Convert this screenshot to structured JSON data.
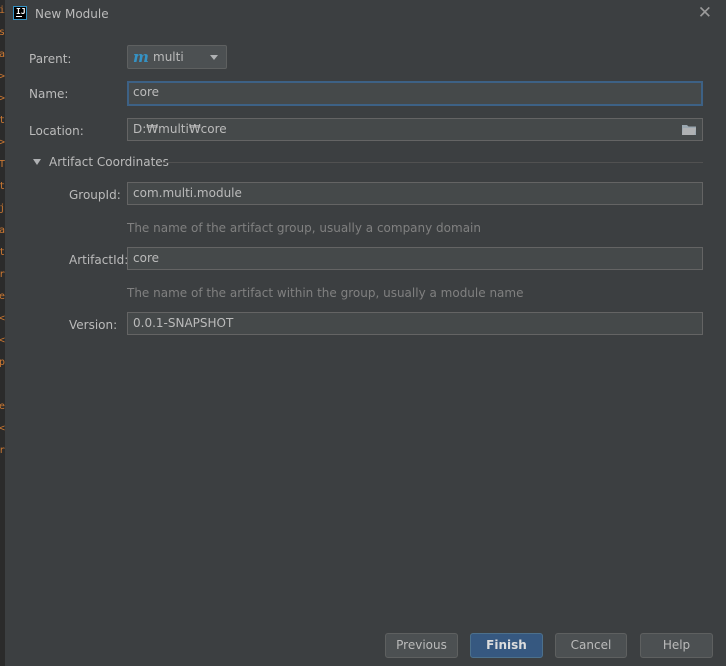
{
  "window": {
    "title": "New Module"
  },
  "editor_gutter": [
    "i",
    "s",
    "a",
    ">",
    ">",
    "t",
    ">",
    "T",
    "t",
    "j",
    "a",
    "t",
    "r",
    "e",
    "<",
    "<",
    "p",
    "",
    "e",
    "<",
    "r"
  ],
  "parent": {
    "label": "Parent:",
    "value": "multi",
    "icon": "maven-m-icon"
  },
  "name": {
    "label": "Name:",
    "value": "core"
  },
  "location": {
    "label": "Location:",
    "value": "D:₩multi₩core",
    "icon": "folder-icon"
  },
  "artifact_coordinates": {
    "title": "Artifact Coordinates",
    "group_id": {
      "label": "GroupId:",
      "value": "com.multi.module",
      "hint": "The name of the artifact group, usually a company domain"
    },
    "artifact_id": {
      "label": "ArtifactId:",
      "value": "core",
      "hint": "The name of the artifact within the group, usually a module name"
    },
    "version": {
      "label": "Version:",
      "value": "0.0.1-SNAPSHOT"
    }
  },
  "buttons": {
    "previous": "Previous",
    "finish": "Finish",
    "cancel": "Cancel",
    "help": "Help"
  },
  "colors": {
    "background": "#3c3f41",
    "field": "#45494a",
    "focus_border": "#3d6185",
    "primary_button": "#365880",
    "accent": "#3592c4"
  }
}
